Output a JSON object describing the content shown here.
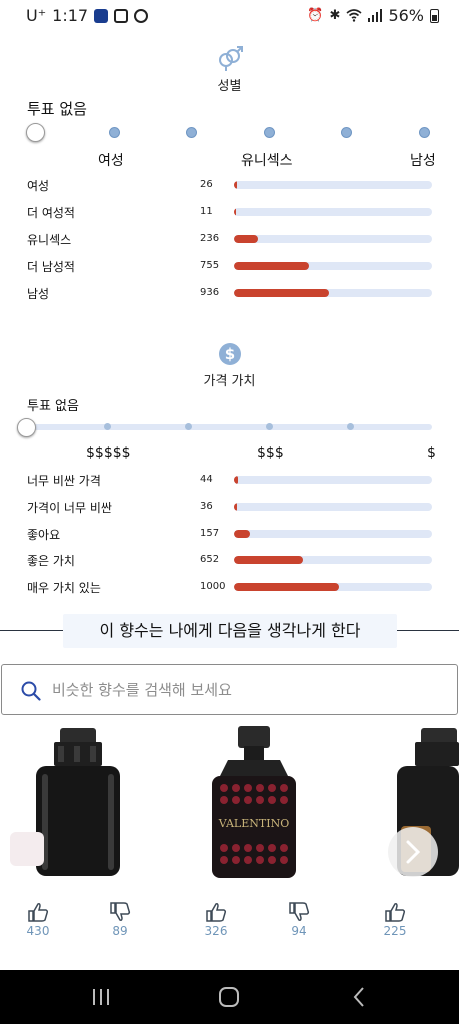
{
  "status_bar": {
    "carrier": "U⁺",
    "time": "1:17",
    "battery": "56%"
  },
  "gender": {
    "title": "성별",
    "no_vote": "투표 없음",
    "scale": [
      "여성",
      "유니섹스",
      "남성"
    ],
    "rows": [
      {
        "label": "여성",
        "count": "26",
        "fill": 0.015
      },
      {
        "label": "더 여성적",
        "count": "11",
        "fill": 0.005
      },
      {
        "label": "유니섹스",
        "count": "236",
        "fill": 0.12
      },
      {
        "label": "더 남성적",
        "count": "755",
        "fill": 0.38
      },
      {
        "label": "남성",
        "count": "936",
        "fill": 0.48
      }
    ]
  },
  "price": {
    "title": "가격 가치",
    "no_vote": "투표 없음",
    "scale": [
      "$$$$$",
      "$$$",
      "$"
    ],
    "rows": [
      {
        "label": "너무 비싼 가격",
        "count": "44",
        "fill": 0.02
      },
      {
        "label": "가격이 너무 비싼",
        "count": "36",
        "fill": 0.015
      },
      {
        "label": "좋아요",
        "count": "157",
        "fill": 0.08
      },
      {
        "label": "좋은 가치",
        "count": "652",
        "fill": 0.35
      },
      {
        "label": "매우 가치 있는",
        "count": "1000",
        "fill": 0.53
      }
    ]
  },
  "reminds": {
    "title": "이 향수는 나에게 다음을 생각나게 한다",
    "search_placeholder": "비슷한 향수를 검색해 보세요",
    "cards": [
      {
        "likes": "430",
        "dislikes": "89"
      },
      {
        "likes": "326",
        "dislikes": "94"
      },
      {
        "likes": "225"
      }
    ],
    "bottle_label": "VALENTINO"
  },
  "colors": {
    "bar_fill": "#c9432e",
    "bar_track": "#dfe7f6",
    "accent_blue": "#6f95b8"
  }
}
